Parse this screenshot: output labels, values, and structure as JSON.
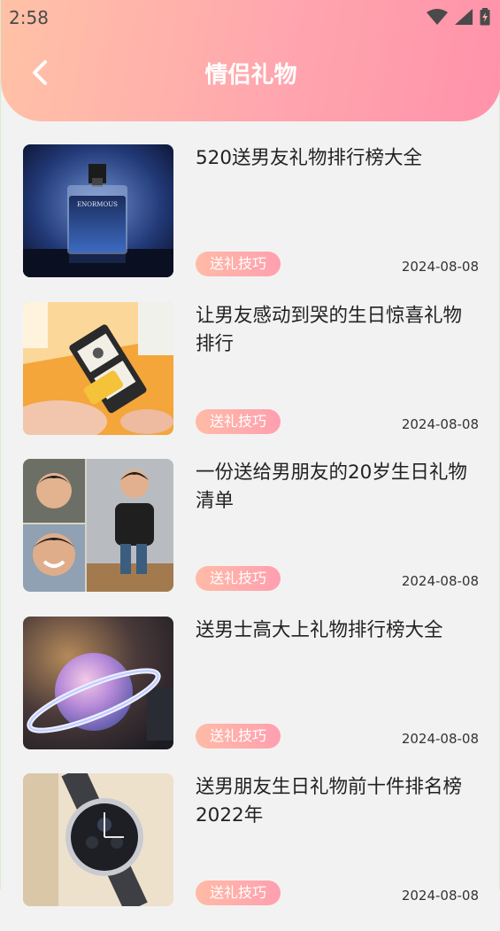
{
  "status": {
    "time": "2:58"
  },
  "header": {
    "title": "情侣礼物"
  },
  "articles": [
    {
      "title": "520送男友礼物排行榜大全",
      "tag": "送礼技巧",
      "date": "2024-08-08"
    },
    {
      "title": "让男友感动到哭的生日惊喜礼物排行",
      "tag": "送礼技巧",
      "date": "2024-08-08"
    },
    {
      "title": "一份送给男朋友的20岁生日礼物清单",
      "tag": "送礼技巧",
      "date": "2024-08-08"
    },
    {
      "title": "送男士高大上礼物排行榜大全",
      "tag": "送礼技巧",
      "date": "2024-08-08"
    },
    {
      "title": "送男朋友生日礼物前十件排名榜2022年",
      "tag": "送礼技巧",
      "date": "2024-08-08"
    }
  ],
  "perfume_label": "ENORMOUS"
}
